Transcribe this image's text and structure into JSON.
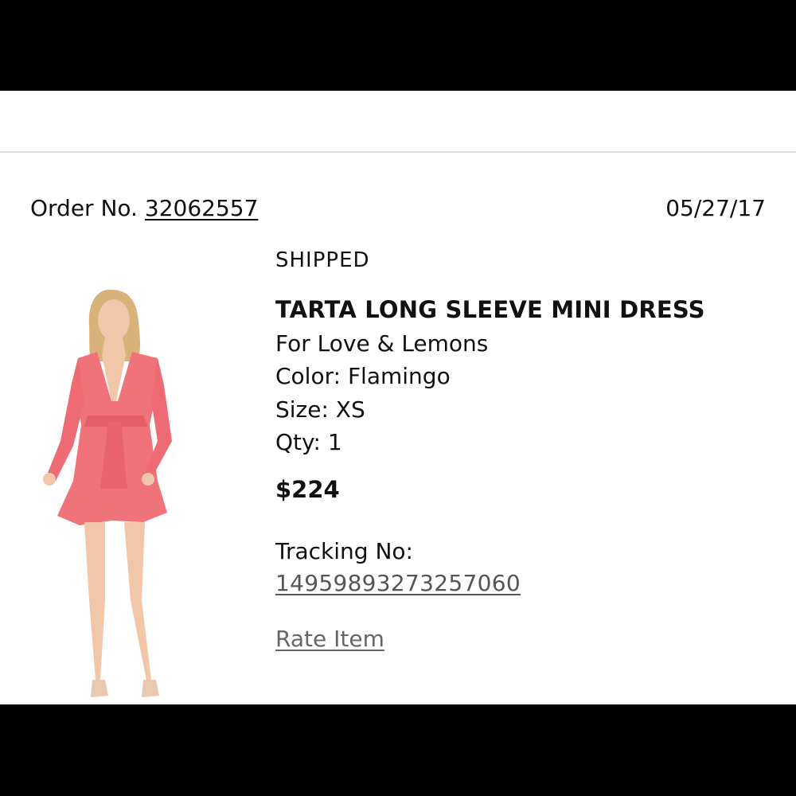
{
  "order": {
    "label": "Order No.",
    "number": "32062557",
    "date": "05/27/17"
  },
  "item": {
    "status": "SHIPPED",
    "name": "TARTA LONG SLEEVE MINI DRESS",
    "brand": "For Love & Lemons",
    "color": "Color: Flamingo",
    "size": "Size: XS",
    "qty": "Qty: 1",
    "price": "$224",
    "tracking_label": "Tracking No:",
    "tracking_number": "14959893273257060",
    "rate_label": "Rate Item",
    "dress_color": "#f0737a"
  }
}
